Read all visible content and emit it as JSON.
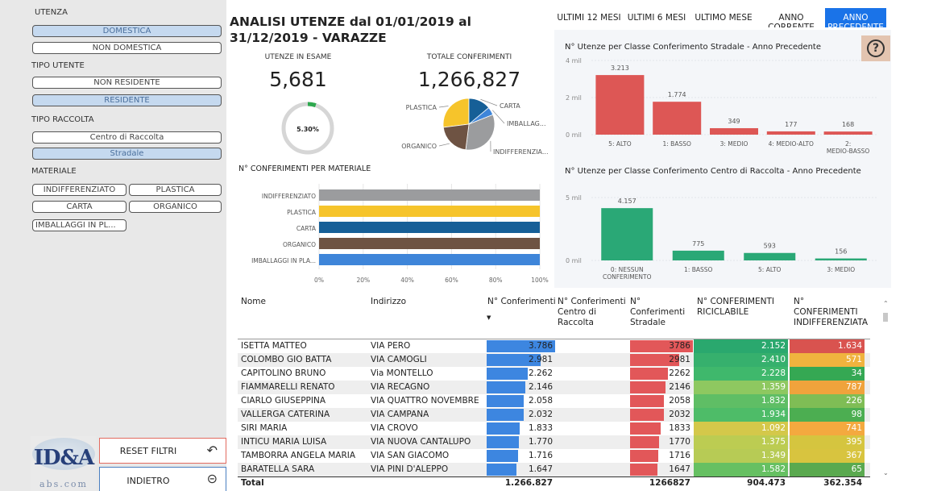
{
  "filters": {
    "utenza": {
      "label": "UTENZA",
      "options": [
        {
          "label": "DOMESTICA",
          "selected": true
        },
        {
          "label": "NON DOMESTICA",
          "selected": false
        }
      ]
    },
    "tipo_utente": {
      "label": "TIPO UTENTE",
      "options": [
        {
          "label": "NON RESIDENTE",
          "selected": false
        },
        {
          "label": "RESIDENTE",
          "selected": true
        }
      ]
    },
    "tipo_raccolta": {
      "label": "TIPO RACCOLTA",
      "options": [
        {
          "label": "Centro di Raccolta",
          "selected": false
        },
        {
          "label": "Stradale",
          "selected": true
        }
      ]
    },
    "materiale": {
      "label": "MATERIALE",
      "options": [
        "INDIFFERENZIATO",
        "PLASTICA",
        "CARTA",
        "ORGANICO",
        "IMBALLAGGI IN PL..."
      ]
    }
  },
  "logo": {
    "text": "ID&A",
    "sub": "abs.com"
  },
  "actions": {
    "reset_label": "RESET FILTRI",
    "back_label": "INDIETRO"
  },
  "title": "ANALISI UTENZE dal 01/01/2019 al 31/12/2019 - VARAZZE",
  "kpis": {
    "utenze_label": "UTENZE IN ESAME",
    "utenze_value": "5,681",
    "conferimenti_label": "TOTALE CONFERIMENTI",
    "conferimenti_value": "1,266,827",
    "gauge_label": "5.30%",
    "gauge_fraction": 0.053
  },
  "tabs": [
    {
      "label": "ULTIMI 12 MESI",
      "active": false
    },
    {
      "label": "ULTIMI 6 MESI",
      "active": false
    },
    {
      "label": "ULTIMO MESE",
      "active": false
    },
    {
      "label": "ANNO CORRENTE",
      "active": false
    },
    {
      "label": "ANNO PRECEDENTE",
      "active": true
    }
  ],
  "help_icon": "help-circle-icon",
  "colors": {
    "accent": "#1a73e8",
    "red": "#dd5755",
    "green": "#2aa876",
    "blue_bar": "#3d86e0"
  },
  "chart_data": [
    {
      "type": "pie",
      "labels": [
        "PLASTICA",
        "CARTA",
        "IMBALLAG...",
        "INDIFFERENZIA...",
        "ORGANICO"
      ],
      "values": [
        27,
        14,
        5,
        33,
        21
      ],
      "colors": [
        "#f6c42b",
        "#165f97",
        "#3e85d9",
        "#9b9c9e",
        "#6e5343"
      ]
    },
    {
      "type": "bar",
      "title": "N° CONFERIMENTI PER MATERIALE",
      "categories": [
        "INDIFFERENZIATO",
        "PLASTICA",
        "CARTA",
        "ORGANICO",
        "IMBALLAGGI IN PLA..."
      ],
      "values": [
        100,
        100,
        100,
        100,
        100
      ],
      "colors": [
        "#9b9c9e",
        "#f6c42b",
        "#165f97",
        "#6e5343",
        "#3e85d9"
      ],
      "xticks": [
        "0%",
        "20%",
        "40%",
        "60%",
        "80%",
        "100%"
      ]
    },
    {
      "type": "bar",
      "title": "N° Utenze per Classe Conferimento Stradale - Anno Precedente",
      "categories": [
        "5: ALTO",
        "1: BASSO",
        "3: MEDIO",
        "4: MEDIO-ALTO",
        "2: MEDIO-BASSO"
      ],
      "values": [
        3213,
        1774,
        349,
        177,
        168
      ],
      "data_labels": [
        "3.213",
        "1.774",
        "349",
        "177",
        "168"
      ],
      "yticks": [
        "4 mil",
        "2 mil",
        "0 mil"
      ],
      "ylim": [
        0,
        4000
      ],
      "color": "#dd5755"
    },
    {
      "type": "bar",
      "title": "N° Utenze per Classe Conferimento Centro di Raccolta - Anno Precedente",
      "categories": [
        "0: NESSUN CONFERIMENTO",
        "1: BASSO",
        "5: ALTO",
        "3: MEDIO"
      ],
      "values": [
        4157,
        775,
        593,
        156
      ],
      "data_labels": [
        "4.157",
        "775",
        "593",
        "156"
      ],
      "yticks": [
        "5 mil",
        "0 mil"
      ],
      "ylim": [
        0,
        5000
      ],
      "color": "#2aa876"
    }
  ],
  "table": {
    "headers": [
      "Nome",
      "Indirizzo",
      "N° Conferimenti",
      "N° Conferimenti Centro di Raccolta",
      "N° Conferimenti Stradale",
      "N° CONFERIMENTI RICICLABILE",
      "N° CONFERIMENTI INDIFFERENZIATA"
    ],
    "rows": [
      [
        "ISETTA MATTEO",
        "VIA PERO",
        "3.786",
        "",
        "3786",
        "2.152",
        "1.634"
      ],
      [
        "COLOMBO GIO BATTA",
        "VIA CAMOGLI",
        "2.981",
        "",
        "2981",
        "2.410",
        "571"
      ],
      [
        "CAPITOLINO BRUNO",
        "Via MONTELLO",
        "2.262",
        "",
        "2262",
        "2.228",
        "34"
      ],
      [
        "FIAMMARELLI RENATO",
        "VIA RECAGNO",
        "2.146",
        "",
        "2146",
        "1.359",
        "787"
      ],
      [
        "CIARLO GIUSEPPINA",
        "VIA QUATTRO NOVEMBRE",
        "2.058",
        "",
        "2058",
        "1.832",
        "226"
      ],
      [
        "VALLERGA CATERINA",
        "VIA CAMPANA",
        "2.032",
        "",
        "2032",
        "1.934",
        "98"
      ],
      [
        "SIRI MARIA",
        "VIA CROVO",
        "1.833",
        "",
        "1833",
        "1.092",
        "741"
      ],
      [
        "INTICU MARIA LUISA",
        "VIA NUOVA CANTALUPO",
        "1.770",
        "",
        "1770",
        "1.375",
        "395"
      ],
      [
        "TAMBORRA ANGELA MARIA",
        "VIA SAN GIACOMO",
        "1.716",
        "",
        "1716",
        "1.349",
        "367"
      ],
      [
        "BARATELLA SARA",
        "VIA PINI D'ALEPPO",
        "1.647",
        "",
        "1647",
        "1.582",
        "65"
      ]
    ],
    "totals": [
      "Total",
      "",
      "1.266.827",
      "",
      "1266827",
      "904.473",
      "362.354"
    ]
  }
}
